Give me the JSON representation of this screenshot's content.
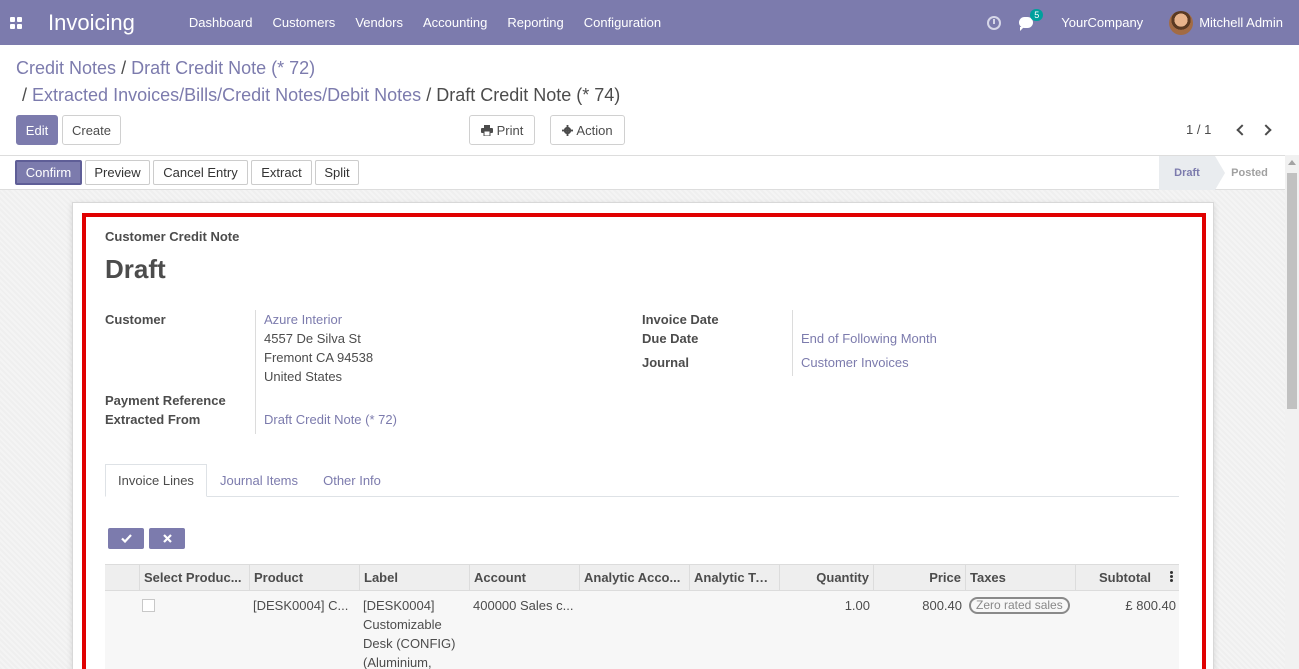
{
  "navbar": {
    "brand": "Invoicing",
    "menu": [
      "Dashboard",
      "Customers",
      "Vendors",
      "Accounting",
      "Reporting",
      "Configuration"
    ],
    "chat_count": "5",
    "company": "YourCompany",
    "user": "Mitchell Admin"
  },
  "breadcrumb": {
    "part1": "Credit Notes",
    "part2": "Draft Credit Note (* 72)",
    "part3": "Extracted Invoices/Bills/Credit Notes/Debit Notes",
    "current": "Draft Credit Note (* 74)",
    "separator": "/"
  },
  "control": {
    "edit": "Edit",
    "create": "Create",
    "print": "Print",
    "action": "Action",
    "pager": "1 / 1"
  },
  "statusbar": {
    "buttons": [
      "Confirm",
      "Preview",
      "Cancel Entry",
      "Extract",
      "Split"
    ],
    "stages": [
      "Draft",
      "Posted"
    ]
  },
  "form": {
    "doc_type": "Customer Credit Note",
    "title": "Draft",
    "customer_label": "Customer",
    "customer_name": "Azure Interior",
    "address_line1": "4557 De Silva St",
    "address_line2": "Fremont CA 94538",
    "address_line3": "United States",
    "payment_reference_label": "Payment Reference",
    "extracted_from_label": "Extracted From",
    "extracted_from_value": "Draft Credit Note (* 72)",
    "invoice_date_label": "Invoice Date",
    "due_date_label": "Due Date",
    "due_date_value": "End of Following Month",
    "journal_label": "Journal",
    "journal_value": "Customer Invoices"
  },
  "tabs": [
    "Invoice Lines",
    "Journal Items",
    "Other Info"
  ],
  "table": {
    "headers": [
      "Select Produc...",
      "Product",
      "Label",
      "Account",
      "Analytic Acco...",
      "Analytic Tags",
      "Quantity",
      "Price",
      "Taxes",
      "Subtotal"
    ],
    "row": {
      "product": "[DESK0004] C...",
      "label_lines": [
        "[DESK0004]",
        "Customizable",
        "Desk (CONFIG)",
        "(Aluminium,"
      ],
      "account": "400000 Sales c...",
      "quantity": "1.00",
      "price": "800.40",
      "tax": "Zero rated sales",
      "subtotal": "£ 800.40"
    }
  }
}
